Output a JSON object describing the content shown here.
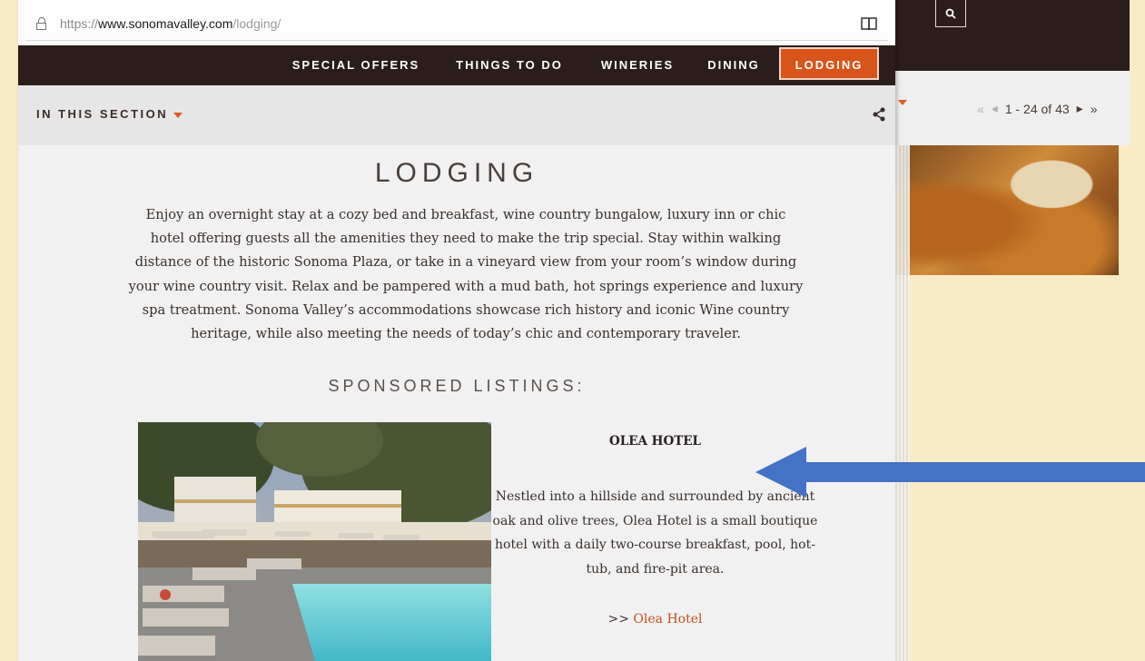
{
  "browser": {
    "url_scheme": "https://",
    "url_domain": "www.sonomavalley.com",
    "url_path": "/lodging/"
  },
  "nav": {
    "items": [
      "SPECIAL OFFERS",
      "THINGS TO DO",
      "WINERIES",
      "DINING",
      "LODGING"
    ],
    "active": "LODGING"
  },
  "section": {
    "label": "IN THIS SECTION"
  },
  "page": {
    "title": "LODGING",
    "intro": "Enjoy an overnight stay at a cozy bed and breakfast, wine country bungalow, luxury inn or chic hotel offering guests all the amenities they need to make the trip special. Stay within walking distance of the historic Sonoma Plaza, or take in a vineyard view from your room’s window during your wine country visit. Relax and be pampered with a mud bath, hot springs experience and luxury spa treatment. Sonoma Valley’s accommodations showcase rich history and iconic Wine country heritage, while also meeting the needs of today’s chic and contemporary traveler.",
    "sponsored_heading": "SPONSORED LISTINGS:",
    "listing": {
      "name": "OLEA HOTEL",
      "description": "Nestled into a hillside and surrounded by ancient oak and olive trees, Olea Hotel is a small boutique hotel with a daily two-course breakfast, pool, hot-tub, and fire-pit area.",
      "link_prefix": ">>",
      "link_text": "Olea Hotel"
    }
  },
  "background_page": {
    "pager_text": "1 - 24 of 43"
  },
  "colors": {
    "nav_bg": "#2b1d1a",
    "accent": "#d9541b",
    "arrow": "#4472c4",
    "page_bg": "#f8ebc6"
  },
  "icons": [
    "lock-icon",
    "reader-view-icon",
    "share-icon",
    "search-icon",
    "caret-down-icon",
    "arrow-annotation"
  ]
}
